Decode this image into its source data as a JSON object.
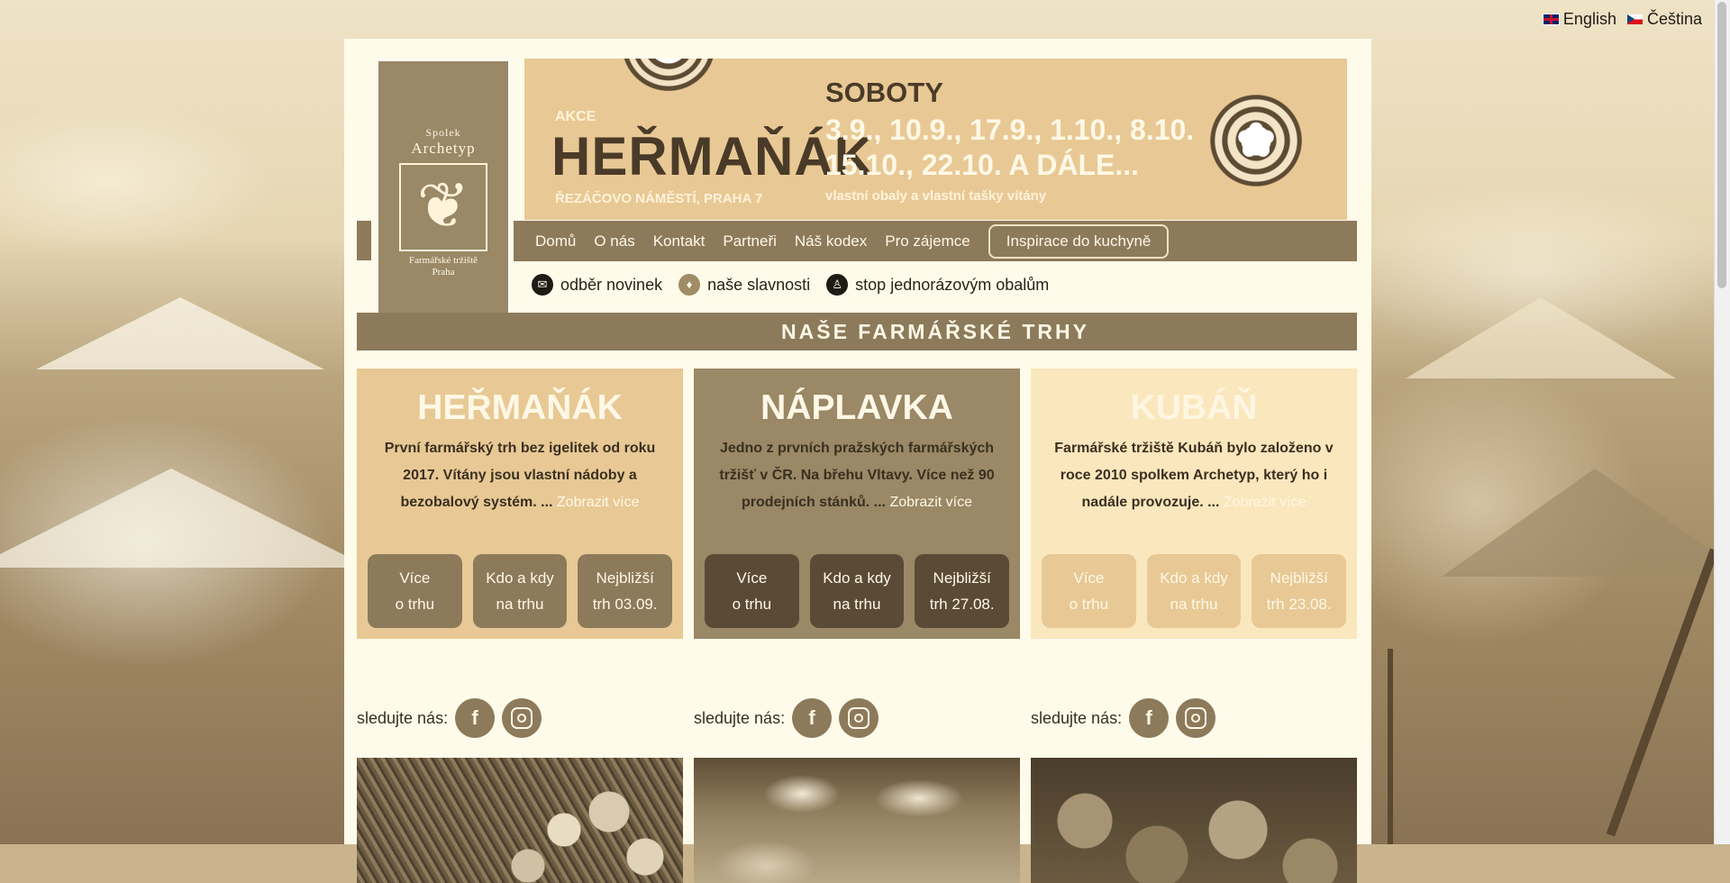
{
  "language": {
    "english": "English",
    "czech": "Čeština"
  },
  "logo": {
    "line1": "Spolek",
    "line2": "Archetyp",
    "line3": "Farmářské tržiště",
    "line4": "Praha"
  },
  "banner": {
    "akce": "AKCE",
    "name": "HEŘMAŇÁK",
    "place": "ŘEZÁČOVO NÁMĚSTÍ, PRAHA 7",
    "days": "SOBOTY",
    "dates_line1": "3.9., 10.9., 17.9., 1.10., 8.10.,",
    "dates_line2": "15.10., 22.10. A DÁLE...",
    "note": "vlastní obaly a vlastní tašky vítány"
  },
  "nav": {
    "items": [
      "Domů",
      "O nás",
      "Kontakt",
      "Partneři",
      "Náš kodex",
      "Pro zájemce"
    ],
    "highlight": "Inspirace do kuchyně"
  },
  "quicklinks": {
    "newsletter": "odběr novinek",
    "festivals": "naše slavnosti",
    "packaging": "stop jednorázovým obalům"
  },
  "section_title": "NAŠE FARMÁŘSKÉ TRHY",
  "markets": [
    {
      "name": "HEŘMAŇÁK",
      "desc": "První farmářský trh bez igelitek od roku 2017. Vítány jsou vlastní nádoby a bezobalový systém. ...",
      "more": "Zobrazit více",
      "btn1_l1": "Více",
      "btn1_l2": "o trhu",
      "btn2_l1": "Kdo a kdy",
      "btn2_l2": "na trhu",
      "btn3_l1": "Nejbližší",
      "btn3_l2": "trh 03.09."
    },
    {
      "name": "NÁPLAVKA",
      "desc": "Jedno z prvních pražských farmářských tržišť v ČR. Na břehu Vltavy. Více než 90 prodejních stánků. ...",
      "more": "Zobrazit více",
      "btn1_l1": "Více",
      "btn1_l2": "o trhu",
      "btn2_l1": "Kdo a kdy",
      "btn2_l2": "na trhu",
      "btn3_l1": "Nejbližší",
      "btn3_l2": "trh 27.08."
    },
    {
      "name": "KUBÁŇ",
      "desc": "Farmářské tržiště Kubáň bylo založeno v roce 2010 spolkem Archetyp, který ho i nadále provozuje. ...",
      "more": "Zobrazit více",
      "btn1_l1": "Více",
      "btn1_l2": "o trhu",
      "btn2_l1": "Kdo a kdy",
      "btn2_l2": "na trhu",
      "btn3_l1": "Nejbližší",
      "btn3_l2": "trh 23.08."
    }
  ],
  "follow_label": "sledujte nás:",
  "social": {
    "facebook": "f"
  },
  "colors": {
    "brown": "#8c7a5b",
    "cream": "#fffbea",
    "sand": "#e8c995",
    "dark": "#5a4a36"
  }
}
